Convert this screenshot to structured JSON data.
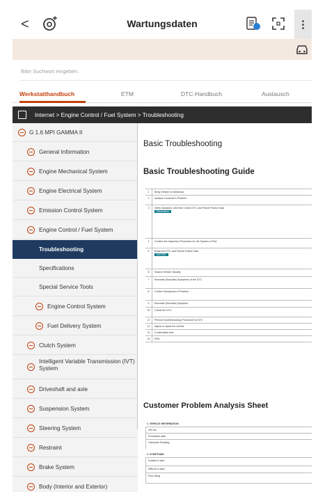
{
  "header": {
    "back": "<",
    "title": "Wartungsdaten"
  },
  "search": {
    "placeholder": "Bitte Suchwort eingeben."
  },
  "tabs": [
    {
      "label": "Werkstatthandbuch",
      "active": true
    },
    {
      "label": "ETM",
      "active": false
    },
    {
      "label": "DTC-Handbuch",
      "active": false
    },
    {
      "label": "Austausch",
      "active": false
    }
  ],
  "breadcrumb": "Internet > Engine Control / Fuel System > Troubleshooting",
  "sidebar": {
    "items": [
      {
        "label": "G 1.6 MPI GAMMA II",
        "level": 0
      },
      {
        "label": "General Information",
        "level": 1
      },
      {
        "label": "Engine Mechanical System",
        "level": 1
      },
      {
        "label": "Engine Electrical System",
        "level": 1
      },
      {
        "label": "Emission Control System",
        "level": 1
      },
      {
        "label": "Engine Control / Fuel System",
        "level": 1
      },
      {
        "label": "Troubleshooting",
        "level": 2,
        "active": true
      },
      {
        "label": "Specifications",
        "level": 2
      },
      {
        "label": "Special Service Tools",
        "level": 2
      },
      {
        "label": "Engine Control System",
        "level": 3
      },
      {
        "label": "Fuel Delivery System",
        "level": 3
      },
      {
        "label": "Clutch System",
        "level": 0
      },
      {
        "label": "Intelligent Variable Transmission (IVT) System",
        "level": 0
      },
      {
        "label": "Driveshaft and axle",
        "level": 0
      },
      {
        "label": "Suspension System",
        "level": 0
      },
      {
        "label": "Steering System",
        "level": 0
      },
      {
        "label": "Restraint",
        "level": 0
      },
      {
        "label": "Brake System",
        "level": 0
      },
      {
        "label": "Body (Interior and Exterior)",
        "level": 0
      }
    ]
  },
  "content": {
    "heading": "Basic Troubleshooting",
    "guide_title": "Basic Troubleshooting Guide",
    "steps": [
      {
        "num": "1",
        "text": "Bring Vehicle to Workshop"
      },
      {
        "num": "2",
        "text": "Analyze Customer's Problem"
      },
      {
        "num": "3",
        "text": "Verify Symptom, and then Check DTC and Freeze Frame Data"
      },
      {
        "num": "4",
        "text": "Confirm the Inspection Procedure for the System or Part"
      },
      {
        "num": "5",
        "text": "Erase the DTC and Freeze Frame Data"
      },
      {
        "num": "6",
        "text": "Inspect Vehicle Visually"
      },
      {
        "num": "7",
        "text": "Recreate (Simulate) Symptoms of the DTC"
      },
      {
        "num": "8",
        "text": "Confirm Symptoms of Problem"
      },
      {
        "num": "9",
        "text": "Recreate (Simulate) Symptom"
      },
      {
        "num": "10",
        "text": "Check the DTC"
      },
      {
        "num": "11",
        "text": "Perform troubleshooting Procedure for DTC"
      },
      {
        "num": "12",
        "text": "Adjust or repair the vehicle"
      },
      {
        "num": "13",
        "text": "Confirmation test"
      },
      {
        "num": "14",
        "text": "END"
      }
    ],
    "information_label": "Information",
    "notice_label": "NOTICE",
    "analysis_title": "Customer Problem Analysis Sheet",
    "form": {
      "section1": "1. VEHICLE INFORMATION",
      "rows1": [
        "VIN No.",
        "Production date",
        "Odometer Reading"
      ],
      "section2": "2. SYMPTOMS",
      "rows2": [
        "Unable to start",
        "Difficult to start",
        "Poor idling"
      ]
    }
  }
}
